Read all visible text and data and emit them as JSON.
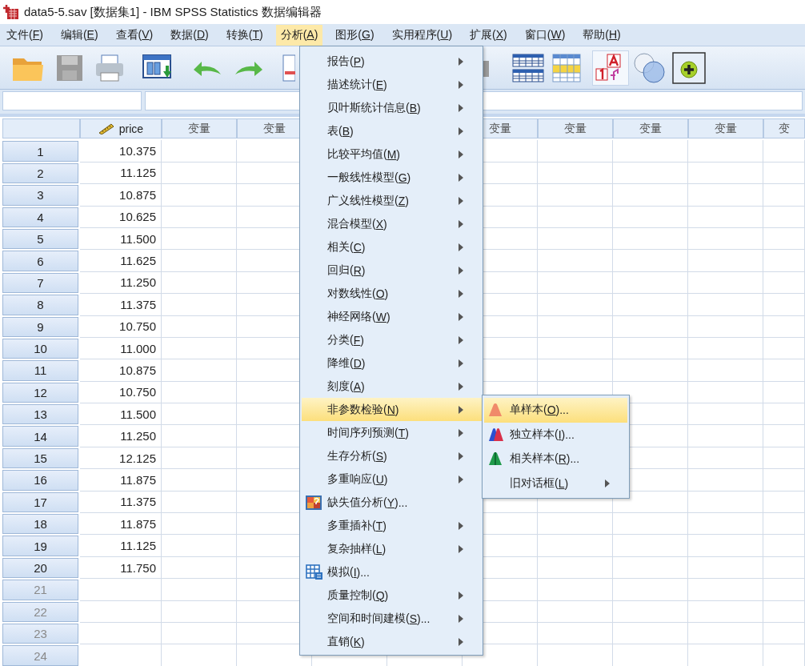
{
  "window": {
    "title": "data5-5.sav [数据集1] - IBM SPSS Statistics 数据编辑器"
  },
  "menubar": [
    {
      "label": "文件(F)",
      "selected": false
    },
    {
      "label": "编辑(E)",
      "selected": false
    },
    {
      "label": "查看(V)",
      "selected": false
    },
    {
      "label": "数据(D)",
      "selected": false
    },
    {
      "label": "转换(T)",
      "selected": false
    },
    {
      "label": "分析(A)",
      "selected": true
    },
    {
      "label": "图形(G)",
      "selected": false
    },
    {
      "label": "实用程序(U)",
      "selected": false
    },
    {
      "label": "扩展(X)",
      "selected": false
    },
    {
      "label": "窗口(W)",
      "selected": false
    },
    {
      "label": "帮助(H)",
      "selected": false
    }
  ],
  "toolbar": {
    "save_disabled": true,
    "value_labels_on": true
  },
  "grid": {
    "columns": [
      {
        "kind": "numeric",
        "header": "price"
      },
      {
        "kind": "blank",
        "header": "变量"
      },
      {
        "kind": "blank",
        "header": "变量"
      },
      {
        "kind": "covered"
      },
      {
        "kind": "covered"
      },
      {
        "kind": "blank",
        "header": "变量"
      },
      {
        "kind": "blank",
        "header": "变量"
      },
      {
        "kind": "blank",
        "header": "变量"
      },
      {
        "kind": "blank",
        "header": "变量"
      },
      {
        "kind": "blank",
        "header": "变"
      }
    ],
    "rows": [
      {
        "number": "1",
        "value": "10.375",
        "empty": false
      },
      {
        "number": "2",
        "value": "11.125",
        "empty": false
      },
      {
        "number": "3",
        "value": "10.875",
        "empty": false
      },
      {
        "number": "4",
        "value": "10.625",
        "empty": false
      },
      {
        "number": "5",
        "value": "11.500",
        "empty": false
      },
      {
        "number": "6",
        "value": "11.625",
        "empty": false
      },
      {
        "number": "7",
        "value": "11.250",
        "empty": false
      },
      {
        "number": "8",
        "value": "11.375",
        "empty": false
      },
      {
        "number": "9",
        "value": "10.750",
        "empty": false
      },
      {
        "number": "10",
        "value": "11.000",
        "empty": false
      },
      {
        "number": "11",
        "value": "10.875",
        "empty": false
      },
      {
        "number": "12",
        "value": "10.750",
        "empty": false
      },
      {
        "number": "13",
        "value": "11.500",
        "empty": false
      },
      {
        "number": "14",
        "value": "11.250",
        "empty": false
      },
      {
        "number": "15",
        "value": "12.125",
        "empty": false
      },
      {
        "number": "16",
        "value": "11.875",
        "empty": false
      },
      {
        "number": "17",
        "value": "11.375",
        "empty": false
      },
      {
        "number": "18",
        "value": "11.875",
        "empty": false
      },
      {
        "number": "19",
        "value": "11.125",
        "empty": false
      },
      {
        "number": "20",
        "value": "11.750",
        "empty": false
      },
      {
        "number": "21",
        "empty": true
      },
      {
        "number": "22",
        "empty": true
      },
      {
        "number": "23",
        "empty": true
      },
      {
        "number": "24",
        "empty": true
      }
    ]
  },
  "analyze_menu": [
    {
      "label": "报告(P)",
      "kind": "submenu",
      "selected": false
    },
    {
      "label": "描述统计(E)",
      "kind": "submenu",
      "selected": false
    },
    {
      "label": "贝叶斯统计信息(B)",
      "kind": "submenu",
      "selected": false
    },
    {
      "label": "表(B)",
      "kind": "submenu",
      "selected": false
    },
    {
      "label": "比较平均值(M)",
      "kind": "submenu",
      "selected": false
    },
    {
      "label": "一般线性模型(G)",
      "kind": "submenu",
      "selected": false
    },
    {
      "label": "广义线性模型(Z)",
      "kind": "submenu",
      "selected": false
    },
    {
      "label": "混合模型(X)",
      "kind": "submenu",
      "selected": false
    },
    {
      "label": "相关(C)",
      "kind": "submenu",
      "selected": false
    },
    {
      "label": "回归(R)",
      "kind": "submenu",
      "selected": false
    },
    {
      "label": "对数线性(O)",
      "kind": "submenu",
      "selected": false
    },
    {
      "label": "神经网络(W)",
      "kind": "submenu",
      "selected": false
    },
    {
      "label": "分类(F)",
      "kind": "submenu",
      "selected": false
    },
    {
      "label": "降维(D)",
      "kind": "submenu",
      "selected": false
    },
    {
      "label": "刻度(A)",
      "kind": "submenu",
      "selected": false
    },
    {
      "label": "非参数检验(N)",
      "kind": "submenu",
      "selected": true
    },
    {
      "label": "时间序列预测(T)",
      "kind": "submenu",
      "selected": false
    },
    {
      "label": "生存分析(S)",
      "kind": "submenu",
      "selected": false
    },
    {
      "label": "多重响应(U)",
      "kind": "submenu",
      "selected": false
    },
    {
      "label": "缺失值分析(Y)...",
      "kind": "dialog",
      "selected": false
    },
    {
      "label": "多重插补(T)",
      "kind": "submenu",
      "selected": false
    },
    {
      "label": "复杂抽样(L)",
      "kind": "submenu",
      "selected": false
    },
    {
      "label": "模拟(I)...",
      "kind": "dialog",
      "selected": false
    },
    {
      "label": "质量控制(Q)",
      "kind": "submenu",
      "selected": false
    },
    {
      "label": "空间和时间建模(S)...",
      "kind": "submenu",
      "selected": false
    },
    {
      "label": "直销(K)",
      "kind": "submenu",
      "selected": false
    }
  ],
  "nonparametric_submenu": [
    {
      "label": "单样本(O)...",
      "kind": "dialog",
      "selected": true
    },
    {
      "label": "独立样本(I)...",
      "kind": "dialog",
      "selected": false
    },
    {
      "label": "相关样本(R)...",
      "kind": "dialog",
      "selected": false
    },
    {
      "label": "旧对话框(L)",
      "kind": "submenu",
      "selected": false
    }
  ]
}
